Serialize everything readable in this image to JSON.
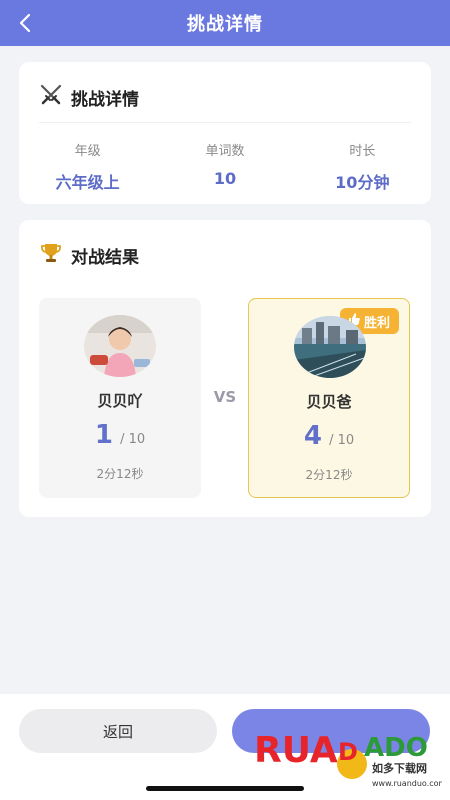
{
  "header": {
    "title": "挑战详情"
  },
  "details": {
    "title": "挑战详情",
    "stats": [
      {
        "label": "年级",
        "value": "六年级上"
      },
      {
        "label": "单词数",
        "value": "10"
      },
      {
        "label": "时长",
        "value": "10分钟"
      }
    ]
  },
  "battle": {
    "title": "对战结果",
    "vs": "VS",
    "left": {
      "name": "贝贝吖",
      "score": "1",
      "total": "/ 10",
      "time": "2分12秒"
    },
    "right": {
      "name": "贝贝爸",
      "score": "4",
      "total": "/ 10",
      "time": "2分12秒",
      "badge": "胜利"
    }
  },
  "footer": {
    "back_label": "返回"
  },
  "watermark": {
    "brand": "RUANDAO",
    "tagline": "如多下载网",
    "url": "www.ruanduo.com"
  },
  "colors": {
    "header": "#6a79e0",
    "accent": "#5d6cc9",
    "winner_border": "#e6c552",
    "badge": "#f6b233"
  }
}
